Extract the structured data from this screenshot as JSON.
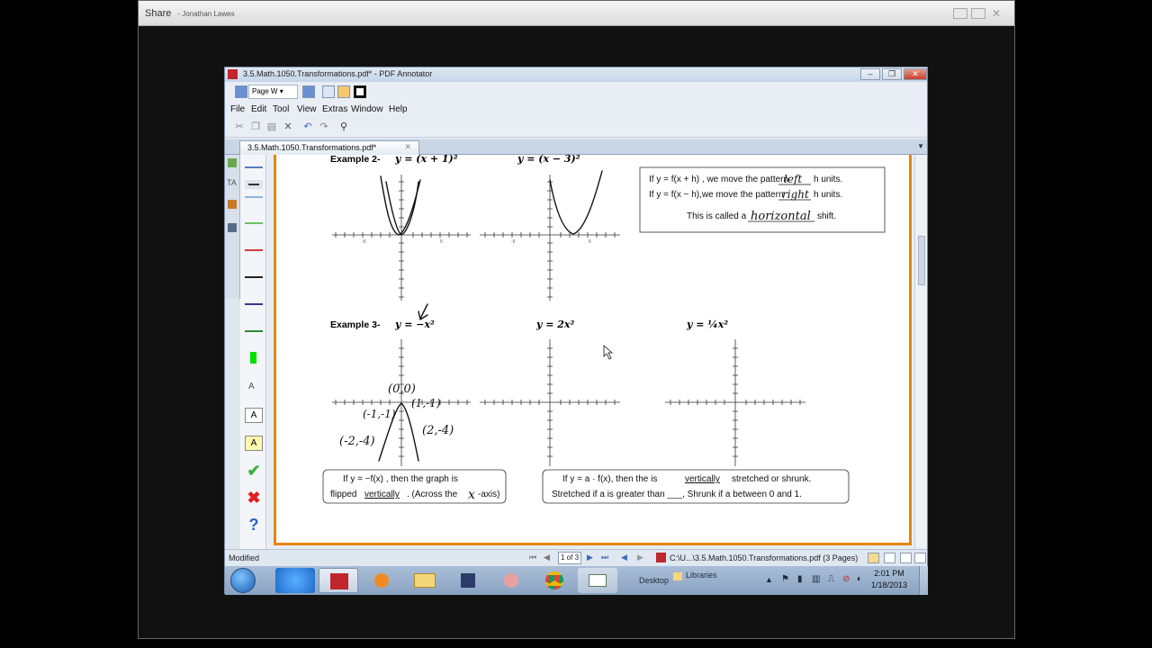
{
  "share": {
    "title": "Share",
    "presenter": "- Jonathan Lawes"
  },
  "app": {
    "window_title": "3.5.Math.1050.Transformations.pdf* - PDF Annotator",
    "zoom_select": "Page W",
    "menu": [
      "File",
      "Edit",
      "Tool",
      "View",
      "Extras",
      "Window",
      "Help"
    ],
    "tab_label": "3.5.Math.1050.Transformations.pdf*"
  },
  "document": {
    "example2_label": "Example 2-",
    "eq2a": "y = (x + 1)²",
    "eq2b": "y = (x − 3)²",
    "box1_line1_pre": "If y = f(x + h) , we move the pattern",
    "box1_line1_post": "h units.",
    "box1_line2_pre": "If y = f(x − h),we move the pattern",
    "box1_line2_post": "h units.",
    "box1_line3_pre": "This is called a",
    "box1_line3_post": "shift.",
    "hw_left": "left",
    "hw_right": "right",
    "hw_horizontal": "horizontal",
    "example3_label": "Example 3-",
    "eq3a": "y = −x²",
    "eq3b": "y = 2x²",
    "eq3c": "y = ¼x²",
    "box2_line1": "If y = −f(x) , then the graph is",
    "box2_line2_pre": "flipped",
    "box2_line2_u": "vertically",
    "box2_line2_post": ". (Across the",
    "box2_line2_end": "-axis)",
    "hw_x": "x",
    "box3_line1_pre": "If y = a · f(x), then the is",
    "box3_line1_u": "vertically",
    "box3_line1_post": "stretched or shrunk.",
    "box3_line2": "Stretched if a is greater than ___, Shrunk if a between 0 and 1.",
    "hw_points": [
      "(0,0)",
      "(1,-1)",
      "(-1,-1)",
      "(-2,-4)",
      "(2,-4)"
    ],
    "tick_neg": "-5",
    "tick_pos": "5"
  },
  "statusbar": {
    "status": "Modified",
    "page_indicator": "1 of 3",
    "file_path": "C:\\U...\\3.5.Math.1050.Transformations.pdf (3 Pages)"
  },
  "taskbar": {
    "desktop_label": "Desktop",
    "libraries_label": "Libraries",
    "time": "2:01 PM",
    "date": "1/18/2013"
  }
}
